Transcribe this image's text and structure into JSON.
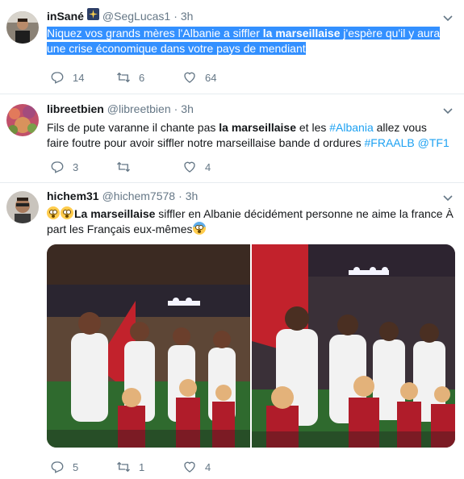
{
  "tweets": [
    {
      "name": "inSané",
      "name_emoji": "sparkle-night-emoji",
      "handle": "@SegLucas1",
      "time": "3h",
      "text": {
        "part1": "Niquez vos grands mères l'Albanie a siffler ",
        "bold": "la marseillaise",
        "part2": " j'espère qu'il y aura une crise économique dans votre pays de mendiant"
      },
      "replies": "14",
      "retweets": "6",
      "likes": "64"
    },
    {
      "name": "libreetbien",
      "handle": "@libreetbien",
      "time": "3h",
      "text": {
        "part1": "Fils de pute varanne il chante pas ",
        "bold": "la marseillaise",
        "part2": " et les ",
        "hashtag1": "#Albania",
        "part3": " allez vous faire foutre pour avoir siffler notre marseillaise bande d ordures ",
        "hashtag2": "#FRAALB",
        "space": " ",
        "mention": "@TF1"
      },
      "replies": "3",
      "retweets": "",
      "likes": "4"
    },
    {
      "name": "hichem31",
      "handle": "@hichem7578",
      "time": "3h",
      "text": {
        "bold": "La marseillaise",
        "part1": " siffler en Albanie décidément personne ne aime la france À part les Français eux-mêmes"
      },
      "emojis": [
        "flushed-face-emoji",
        "flushed-face-emoji",
        "fearful-face-emoji"
      ],
      "replies": "5",
      "retweets": "1",
      "likes": "4"
    }
  ],
  "icons": {
    "reply": "reply-icon",
    "retweet": "retweet-icon",
    "like": "heart-icon",
    "menu": "chevron-down-icon"
  },
  "colors": {
    "text": "#14171a",
    "muted": "#657786",
    "link": "#1da1f2",
    "highlight": "#3390ff",
    "divider": "#e6ecf0"
  }
}
